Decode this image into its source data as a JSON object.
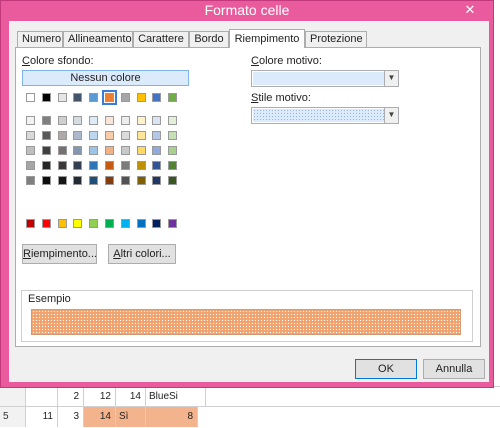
{
  "dialog": {
    "title": "Formato celle",
    "close_icon": "close-icon",
    "accent": "#e95b9c"
  },
  "tabs": [
    {
      "label": "Numero"
    },
    {
      "label": "Allineamento"
    },
    {
      "label": "Carattere"
    },
    {
      "label": "Bordo"
    },
    {
      "label": "Riempimento",
      "active": true
    },
    {
      "label": "Protezione"
    }
  ],
  "fill": {
    "background_label": "Colore sfondo:",
    "no_color_label": "Nessun colore",
    "fill_effects_label": "Riempimento...",
    "more_colors_label": "Altri colori...",
    "selected_color": "#ed7d31",
    "theme_row": [
      "#ffffff",
      "#000000",
      "#e7e6e6",
      "#44546a",
      "#5b9bd5",
      "#ed7d31",
      "#a5a5a5",
      "#ffc000",
      "#4472c4",
      "#70ad47"
    ],
    "tints": [
      [
        "#f2f2f2",
        "#7f7f7f",
        "#d0cece",
        "#d6dce4",
        "#ddebf7",
        "#fbe5d6",
        "#ededed",
        "#fff2cc",
        "#dae3f3",
        "#e2f0d9"
      ],
      [
        "#d9d9d9",
        "#595959",
        "#aeaaaa",
        "#adb9ca",
        "#bdd7ee",
        "#f8cbad",
        "#dbdbdb",
        "#ffe699",
        "#b4c7e7",
        "#c5e0b4"
      ],
      [
        "#bfbfbf",
        "#404040",
        "#757171",
        "#8497b0",
        "#9dc3e6",
        "#f4b183",
        "#c9c9c9",
        "#ffd966",
        "#8faadc",
        "#a9d18e"
      ],
      [
        "#a6a6a6",
        "#262626",
        "#3a3838",
        "#333f50",
        "#2e75b6",
        "#c55a11",
        "#7b7b7b",
        "#bf9000",
        "#2f5597",
        "#548235"
      ],
      [
        "#808080",
        "#0d0d0d",
        "#171616",
        "#222a35",
        "#1f4e79",
        "#843c0c",
        "#525252",
        "#7f6000",
        "#203864",
        "#385723"
      ]
    ],
    "standard_row": [
      "#c00000",
      "#ff0000",
      "#ffc000",
      "#ffff00",
      "#92d050",
      "#00b050",
      "#00b0f0",
      "#0070c0",
      "#002060",
      "#7030a0"
    ]
  },
  "pattern": {
    "color_label": "Colore motivo:",
    "color_value": "",
    "style_label": "Stile motivo:",
    "style_value": ""
  },
  "sample": {
    "label": "Esempio",
    "fill_color": "#f0a36e"
  },
  "footer": {
    "ok_label": "OK",
    "cancel_label": "Annulla"
  },
  "sheet": {
    "rows": [
      {
        "header": "",
        "cells": [
          "",
          "2",
          "12",
          "14",
          "",
          "BlueSi"
        ]
      },
      {
        "header": "5",
        "cells": [
          "11",
          "3",
          "14",
          "Sì",
          "8"
        ]
      }
    ]
  }
}
